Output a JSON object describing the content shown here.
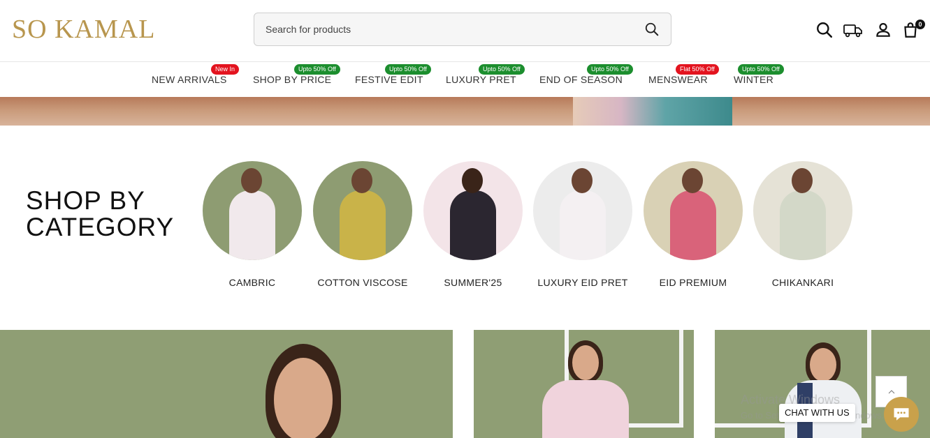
{
  "header": {
    "logo": "SO KAMAL",
    "search": {
      "placeholder": "Search for products",
      "value": ""
    },
    "icons": [
      "search-icon",
      "delivery-truck-icon",
      "user-icon",
      "shopping-bag-icon"
    ],
    "cart_count": "0"
  },
  "nav": {
    "items": [
      {
        "label": "NEW ARRIVALS",
        "badge": "New In",
        "badge_color": "#e3141f"
      },
      {
        "label": "SHOP BY PRICE",
        "badge": "Upto 50% Off",
        "badge_color": "#1c8e2e"
      },
      {
        "label": "FESTIVE EDIT",
        "badge": "Upto 50% Off",
        "badge_color": "#1c8e2e"
      },
      {
        "label": "LUXURY PRET",
        "badge": "Upto 50% Off",
        "badge_color": "#1c8e2e"
      },
      {
        "label": "END OF SEASON",
        "badge": "Upto 50% Off",
        "badge_color": "#1c8e2e"
      },
      {
        "label": "MENSWEAR",
        "badge": "Flat 50% Off",
        "badge_color": "#e3141f"
      },
      {
        "label": "WINTER",
        "badge": "Upto 50% Off",
        "badge_color": "#1c8e2e"
      }
    ]
  },
  "category_section": {
    "title_line1": "SHOP BY",
    "title_line2": "CATEGORY",
    "categories": [
      {
        "label": "CAMBRIC"
      },
      {
        "label": "COTTON VISCOSE"
      },
      {
        "label": "SUMMER'25"
      },
      {
        "label": "LUXURY EID PRET"
      },
      {
        "label": "EID PREMIUM"
      },
      {
        "label": "CHIKANKARI"
      }
    ]
  },
  "overlay": {
    "watermark_line1": "Activate Windows",
    "watermark_line2": "Go to Settings to activate Windows.",
    "chat_label": "CHAT WITH US"
  },
  "colors": {
    "brand_gold": "#b8964e",
    "badge_red": "#e3141f",
    "badge_green": "#1c8e2e",
    "chat_gold": "#c9a14b"
  }
}
